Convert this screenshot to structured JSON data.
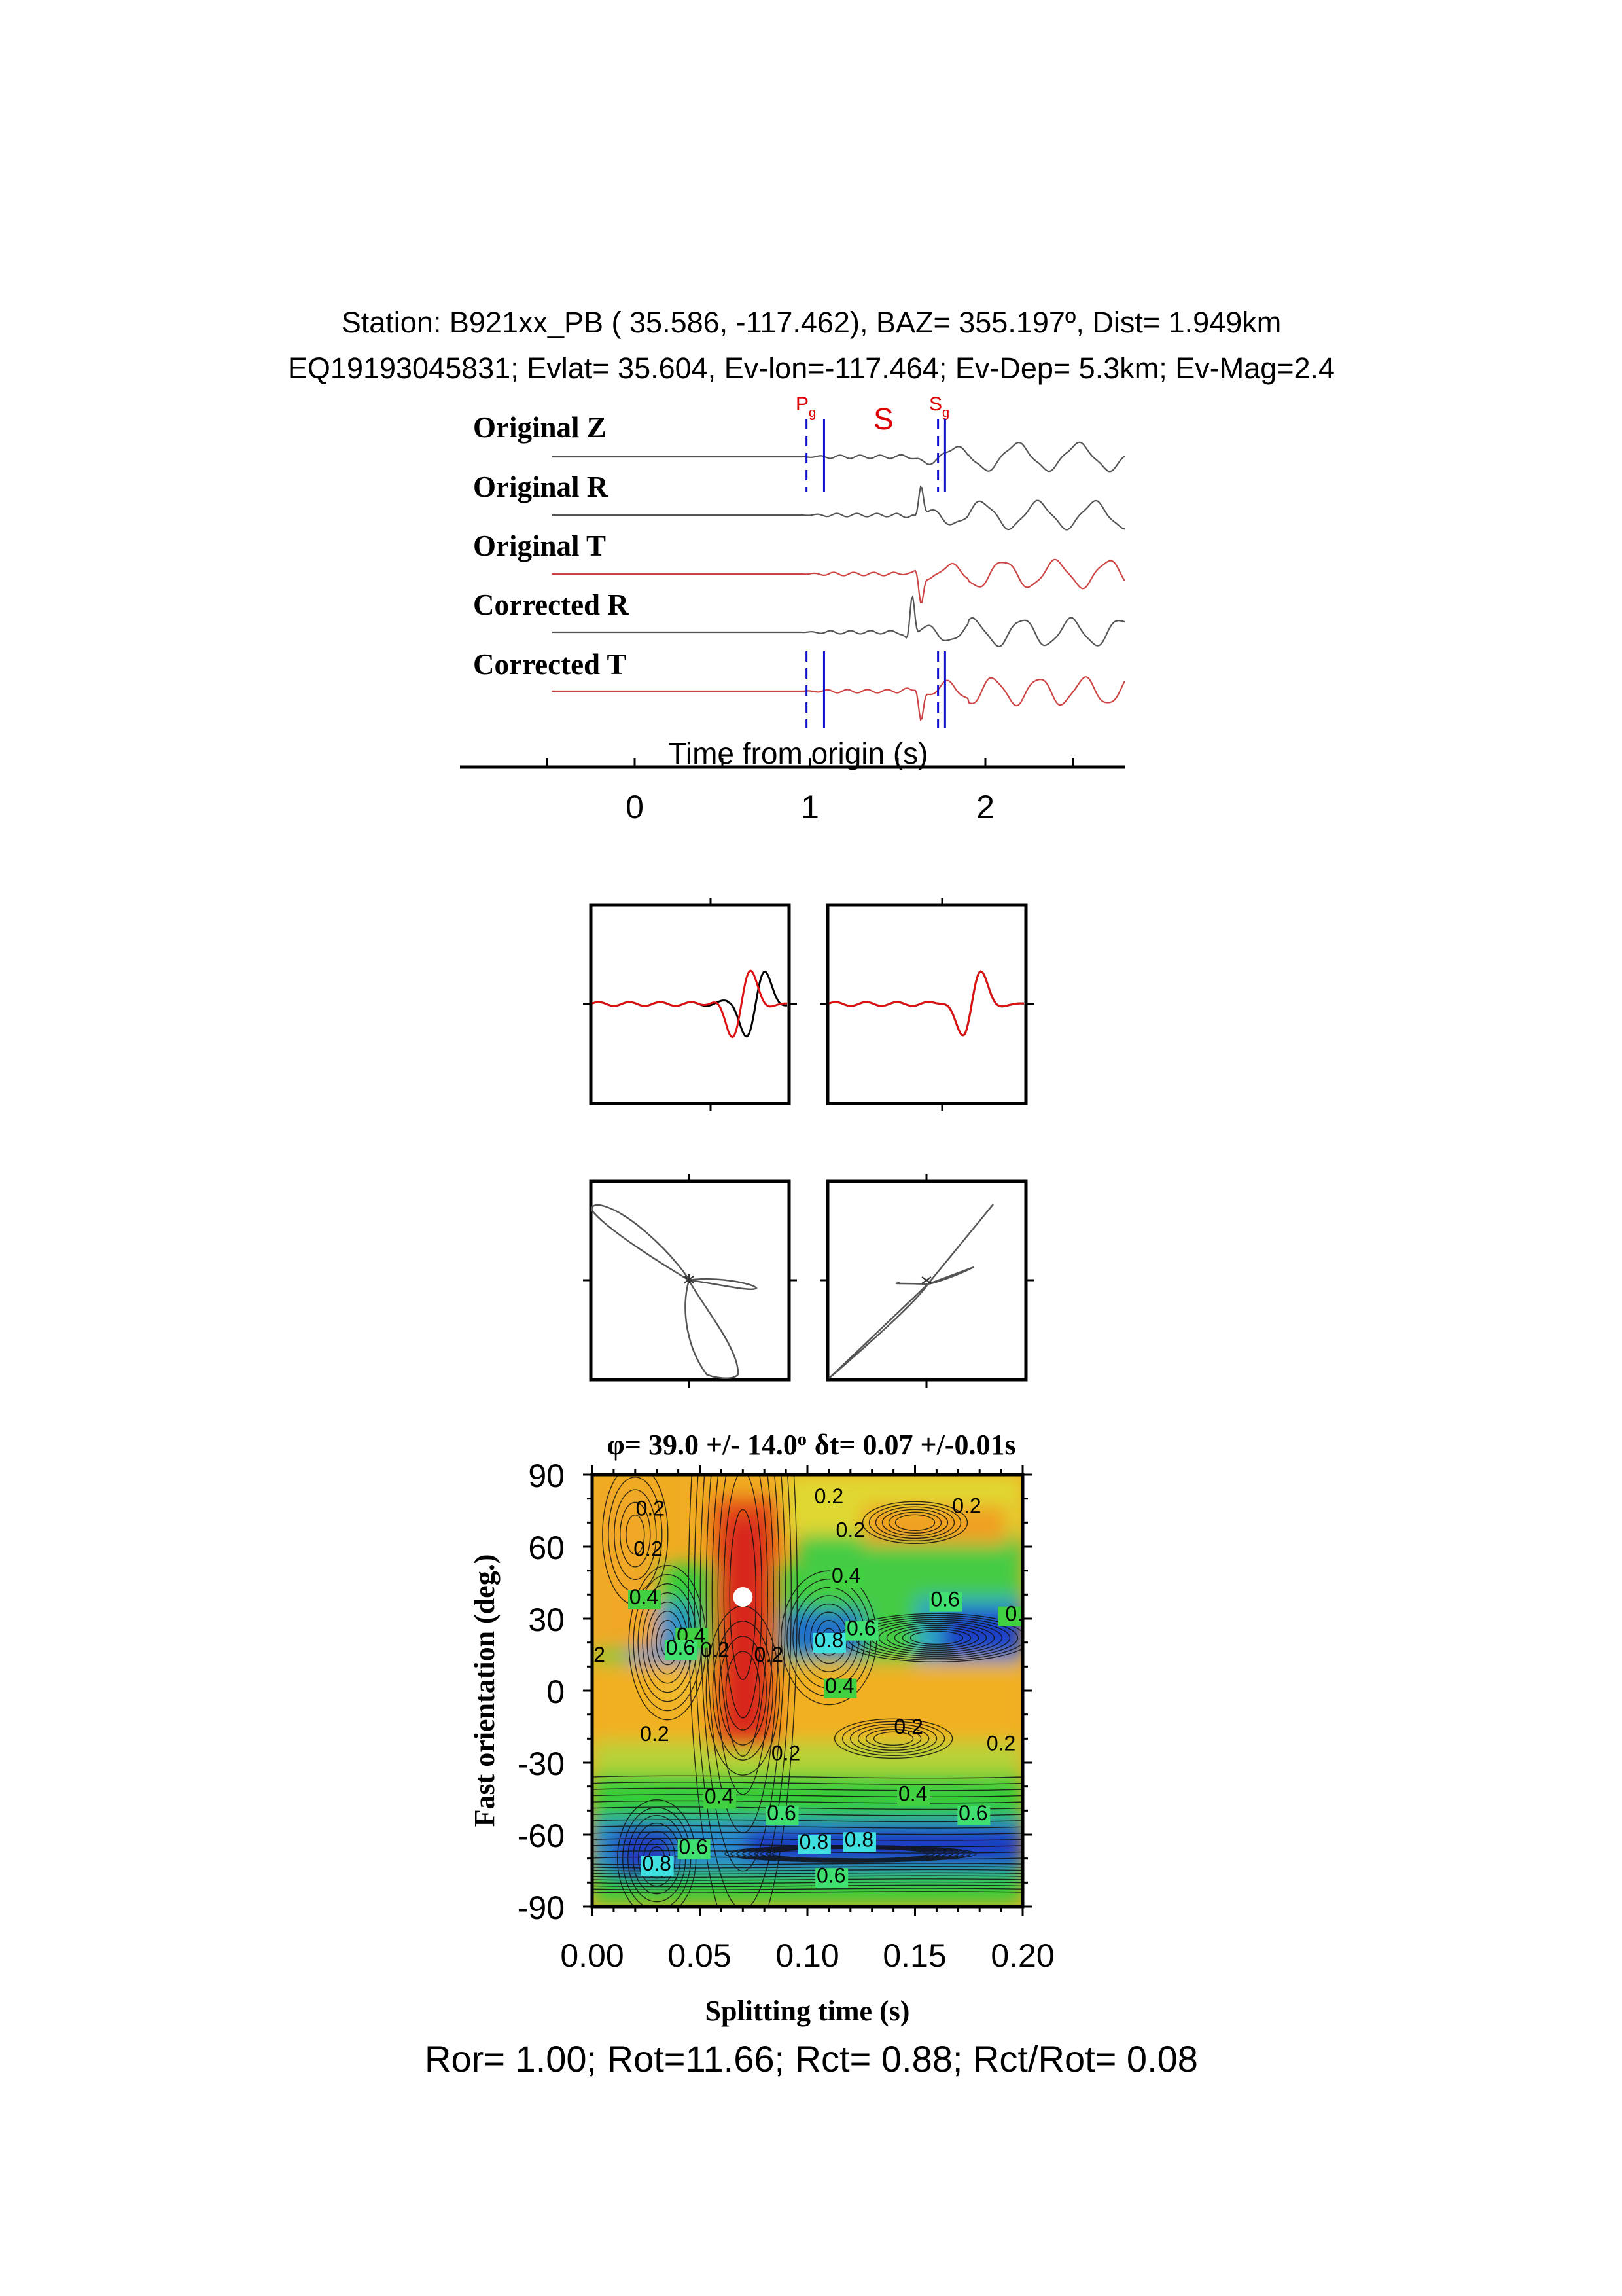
{
  "header": {
    "line1": "Station: B921xx_PB ( 35.586, -117.462), BAZ=  355.197º, Dist=    1.949km",
    "line2": "EQ19193045831; Evlat=  35.604, Ev-lon=-117.464; Ev-Dep=  5.3km; Ev-Mag=2.4"
  },
  "phases": {
    "pg_main": "P",
    "pg_sub": "g",
    "s": "S",
    "sg_main": "S",
    "sg_sub": "g"
  },
  "colors": {
    "trace_black": "#555555",
    "trace_red": "#cc4444",
    "phase_red": "#dd0000",
    "marker_blue": "#1111cc",
    "contour": "#111111"
  },
  "chart_data": [
    {
      "type": "line",
      "panel": "seismograms",
      "xlabel": "Time from origin (s)",
      "xticks": [
        0,
        1,
        2
      ],
      "xlim": [
        -1,
        2.8
      ],
      "series": [
        {
          "name": "Original Z",
          "color": "black"
        },
        {
          "name": "Original R",
          "color": "black"
        },
        {
          "name": "Original T",
          "color": "red"
        },
        {
          "name": "Corrected R",
          "color": "black"
        },
        {
          "name": "Corrected T",
          "color": "red"
        }
      ],
      "arrival_markers": [
        {
          "phase": "Pg",
          "time": 0.98,
          "style": "dashed"
        },
        {
          "phase": "Pg",
          "time": 1.08,
          "style": "solid"
        },
        {
          "phase": "Sg",
          "time": 1.73,
          "style": "dashed"
        },
        {
          "phase": "Sg",
          "time": 1.77,
          "style": "solid"
        }
      ]
    },
    {
      "type": "line",
      "panel": "waveform-comparison",
      "series": [
        {
          "name": "fast",
          "color": "black"
        },
        {
          "name": "slow",
          "color": "red"
        }
      ]
    },
    {
      "type": "scatter",
      "panel": "particle-motion",
      "description_free": true
    },
    {
      "type": "heatmap",
      "panel": "grid-search",
      "title": "φ= 39.0 +/- 14.0º δt= 0.07 +/-0.01s",
      "xlabel": "Splitting time (s)",
      "ylabel": "Fast orientation (deg.)",
      "xlim": [
        0.0,
        0.2
      ],
      "ylim": [
        -90,
        90
      ],
      "xticks": [
        "0.00",
        "0.05",
        "0.10",
        "0.15",
        "0.20"
      ],
      "yticks": [
        "90",
        "60",
        "30",
        "0",
        "-30",
        "-60",
        "-90"
      ],
      "best": {
        "phi": 39.0,
        "dt": 0.07
      },
      "contour_labels": [
        {
          "x": 0.027,
          "y": 73,
          "text": "0.2"
        },
        {
          "x": 0.026,
          "y": 56,
          "text": "0.2"
        },
        {
          "x": 0.024,
          "y": 36,
          "text": "0.4"
        },
        {
          "x": 0.046,
          "y": 20,
          "text": "0.4"
        },
        {
          "x": 0.041,
          "y": 15,
          "text": "0.6"
        },
        {
          "x": 0.057,
          "y": 14,
          "text": "0.2"
        },
        {
          "x": 0.082,
          "y": 12,
          "text": "0.2"
        },
        {
          "x": 0.002,
          "y": 12,
          "text": ".2"
        },
        {
          "x": 0.11,
          "y": 18,
          "text": "0.8"
        },
        {
          "x": 0.125,
          "y": 23,
          "text": "0.6"
        },
        {
          "x": 0.118,
          "y": 45,
          "text": "0.4"
        },
        {
          "x": 0.11,
          "y": 78,
          "text": "0.2"
        },
        {
          "x": 0.12,
          "y": 64,
          "text": "0.2"
        },
        {
          "x": 0.174,
          "y": 74,
          "text": "0.2"
        },
        {
          "x": 0.164,
          "y": 35,
          "text": "0.6"
        },
        {
          "x": 0.196,
          "y": 29,
          "text": "0."
        },
        {
          "x": 0.115,
          "y": -1,
          "text": "0.4"
        },
        {
          "x": 0.029,
          "y": -21,
          "text": "0.2"
        },
        {
          "x": 0.147,
          "y": -18,
          "text": "0.2"
        },
        {
          "x": 0.19,
          "y": -25,
          "text": "0.2"
        },
        {
          "x": 0.09,
          "y": -29,
          "text": "0.2"
        },
        {
          "x": 0.059,
          "y": -47,
          "text": "0.4"
        },
        {
          "x": 0.088,
          "y": -54,
          "text": "0.6"
        },
        {
          "x": 0.149,
          "y": -46,
          "text": "0.4"
        },
        {
          "x": 0.177,
          "y": -54,
          "text": "0.6"
        },
        {
          "x": 0.047,
          "y": -68,
          "text": "0.6"
        },
        {
          "x": 0.03,
          "y": -75,
          "text": "0.8"
        },
        {
          "x": 0.103,
          "y": -66,
          "text": "0.8"
        },
        {
          "x": 0.124,
          "y": -65,
          "text": "0.8"
        },
        {
          "x": 0.111,
          "y": -80,
          "text": "0.6"
        }
      ],
      "annotation": "Ror= 1.00; Rot=11.66; Rct= 0.88; Rct/Rot= 0.08"
    }
  ],
  "labels": {
    "trace_labels": [
      "Original Z",
      "Original R",
      "Original T",
      "Corrected R",
      "Corrected T"
    ],
    "time_axis_label": "Time from origin (s)",
    "time_ticks": [
      "0",
      "1",
      "2"
    ],
    "grid_title_phi": "φ",
    "grid_title_text1": "= 39.0 +/- 14.0",
    "grid_title_deg": "o",
    "grid_title_delta": "δ",
    "grid_title_text2": "t= 0.07 +/-0.01s",
    "grid_xlabel": "Splitting time (s)",
    "grid_ylabel": "Fast orientation (deg.)",
    "footer": "Ror= 1.00; Rot=11.66; Rct= 0.88; Rct/Rot= 0.08"
  }
}
